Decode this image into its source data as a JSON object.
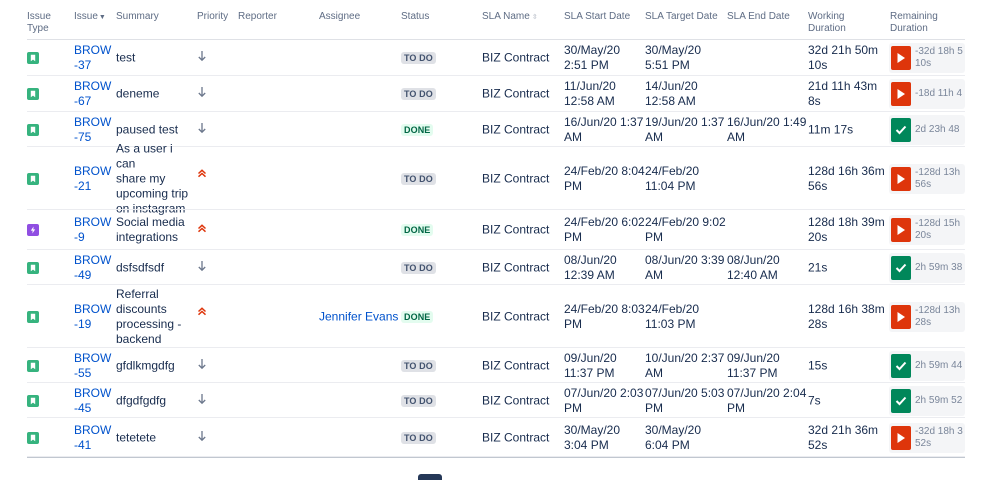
{
  "headers": {
    "issue_type": "Issue Type",
    "issue": "Issue",
    "summary": "Summary",
    "priority": "Priority",
    "reporter": "Reporter",
    "assignee": "Assignee",
    "status": "Status",
    "sla_name": "SLA Name",
    "sla_start": "SLA Start Date",
    "sla_target": "SLA Target Date",
    "sla_end": "SLA End Date",
    "working_duration": "Working Duration",
    "remaining_duration": "Remaining Duration"
  },
  "colors": {
    "story": "#36b37e",
    "epic": "#904ee2",
    "link": "#0052cc",
    "sla_paused": "#de350b",
    "sla_met": "#00875a",
    "priority_high": "#de350b",
    "priority_low": "#6b778c"
  },
  "rows": [
    {
      "type": "story",
      "key": "BROW\n-37",
      "summary": "test",
      "priority": "low",
      "reporter": "",
      "assignee": "",
      "status": "TO DO",
      "sla_name": "BIZ Contract",
      "start": "30/May/20\n2:51 PM",
      "target": "30/May/20\n5:51 PM",
      "end": "",
      "working": "32d 21h 50m\n10s",
      "remaining_state": "paused",
      "remaining": "-32d 18h 5\n10s"
    },
    {
      "type": "story",
      "key": "BROW\n-67",
      "summary": "deneme",
      "priority": "low",
      "reporter": "",
      "assignee": "",
      "status": "TO DO",
      "sla_name": "BIZ Contract",
      "start": "11/Jun/20\n12:58 AM",
      "target": "14/Jun/20\n12:58 AM",
      "end": "",
      "working": "21d 11h 43m\n8s",
      "remaining_state": "paused",
      "remaining": "-18d 11h 4"
    },
    {
      "type": "story",
      "key": "BROW\n-75",
      "summary": "paused test",
      "priority": "low",
      "reporter": "",
      "assignee": "",
      "status": "DONE",
      "sla_name": "BIZ Contract",
      "start": "16/Jun/20 1:37\nAM",
      "target": "19/Jun/20 1:37\nAM",
      "end": "16/Jun/20 1:49\nAM",
      "working": "11m 17s",
      "remaining_state": "met",
      "remaining": "2d 23h 48"
    },
    {
      "type": "story",
      "key": "BROW\n-21",
      "summary": "As a user i can\nshare my\nupcoming trip\non instagram",
      "priority": "high",
      "reporter": "",
      "assignee": "",
      "status": "TO DO",
      "sla_name": "BIZ Contract",
      "start": "24/Feb/20 8:04\nPM",
      "target": "24/Feb/20\n11:04 PM",
      "end": "",
      "working": "128d 16h 36m\n56s",
      "remaining_state": "paused",
      "remaining": "-128d 13h\n56s"
    },
    {
      "type": "epic",
      "key": "BROW\n-9",
      "summary": "Social media\nintegrations",
      "priority": "high",
      "reporter": "",
      "assignee": "",
      "status": "DONE",
      "sla_name": "BIZ Contract",
      "start": "24/Feb/20 6:02\nPM",
      "target": "24/Feb/20 9:02\nPM",
      "end": "",
      "working": "128d 18h 39m\n20s",
      "remaining_state": "paused",
      "remaining": "-128d 15h\n20s"
    },
    {
      "type": "story",
      "key": "BROW\n-49",
      "summary": "dsfsdfsdf",
      "priority": "low",
      "reporter": "",
      "assignee": "",
      "status": "TO DO",
      "sla_name": "BIZ Contract",
      "start": "08/Jun/20\n12:39 AM",
      "target": "08/Jun/20 3:39\nAM",
      "end": "08/Jun/20\n12:40 AM",
      "working": "21s",
      "remaining_state": "met",
      "remaining": "2h 59m 38"
    },
    {
      "type": "story",
      "key": "BROW\n-19",
      "summary": "Referral\ndiscounts\nprocessing -\nbackend",
      "priority": "high",
      "reporter": "",
      "assignee": "Jennifer Evans",
      "status": "DONE",
      "sla_name": "BIZ Contract",
      "start": "24/Feb/20 8:03\nPM",
      "target": "24/Feb/20\n11:03 PM",
      "end": "",
      "working": "128d 16h 38m\n28s",
      "remaining_state": "paused",
      "remaining": "-128d 13h\n28s"
    },
    {
      "type": "story",
      "key": "BROW\n-55",
      "summary": "gfdlkmgdfg",
      "priority": "low",
      "reporter": "",
      "assignee": "",
      "status": "TO DO",
      "sla_name": "BIZ Contract",
      "start": "09/Jun/20\n11:37 PM",
      "target": "10/Jun/20 2:37\nAM",
      "end": "09/Jun/20\n11:37 PM",
      "working": "15s",
      "remaining_state": "met",
      "remaining": "2h 59m 44"
    },
    {
      "type": "story",
      "key": "BROW\n-45",
      "summary": "dfgdfgdfg",
      "priority": "low",
      "reporter": "",
      "assignee": "",
      "status": "TO DO",
      "sla_name": "BIZ Contract",
      "start": "07/Jun/20 2:03\nPM",
      "target": "07/Jun/20 5:03\nPM",
      "end": "07/Jun/20 2:04\nPM",
      "working": "7s",
      "remaining_state": "met",
      "remaining": "2h 59m 52"
    },
    {
      "type": "story",
      "key": "BROW\n-41",
      "summary": "tetetete",
      "priority": "low",
      "reporter": "",
      "assignee": "",
      "status": "TO DO",
      "sla_name": "BIZ Contract",
      "start": "30/May/20\n3:04 PM",
      "target": "30/May/20\n6:04 PM",
      "end": "",
      "working": "32d 21h 36m\n52s",
      "remaining_state": "paused",
      "remaining": "-32d 18h 3\n52s"
    }
  ]
}
